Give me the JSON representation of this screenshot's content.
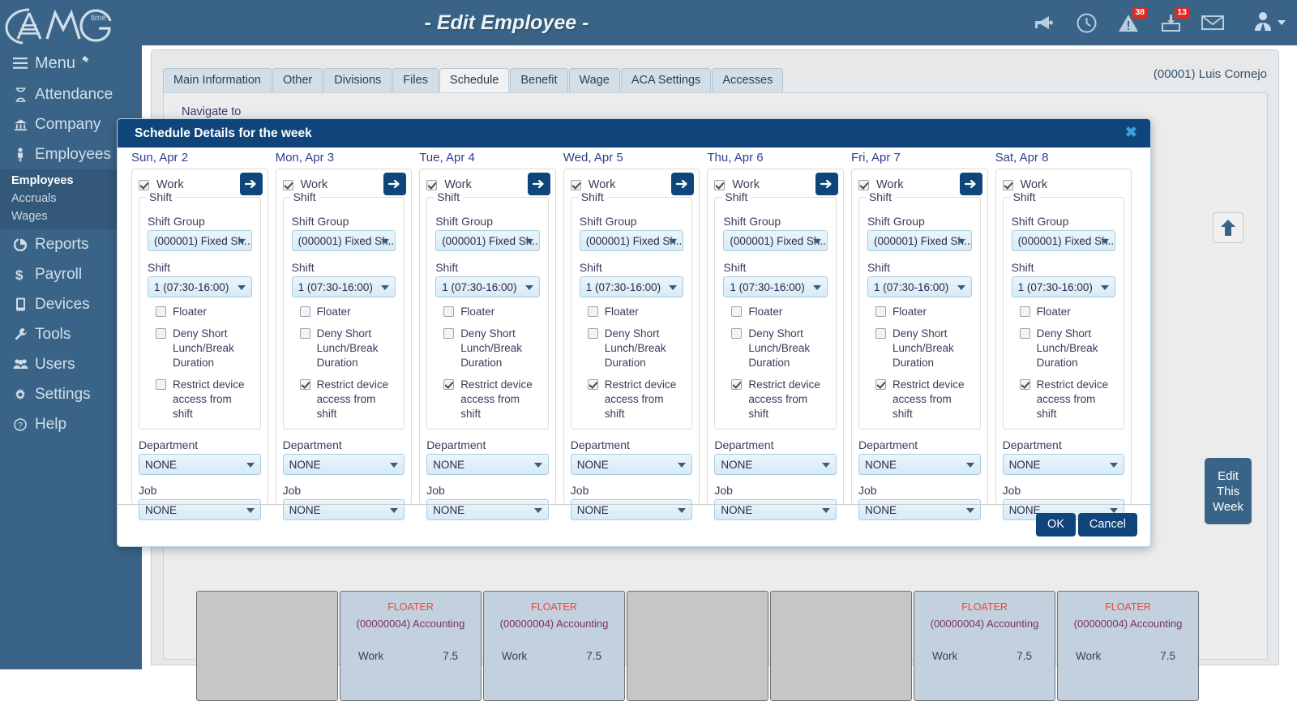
{
  "app": {
    "logo_text": "AMG",
    "logo_sub": "time",
    "title": "- Edit Employee -"
  },
  "sidebar": {
    "menu_label": "Menu",
    "items": [
      {
        "label": "Attendance",
        "icon": "hourglass-icon"
      },
      {
        "label": "Company",
        "icon": "bank-icon"
      },
      {
        "label": "Employees",
        "icon": "person-icon"
      },
      {
        "label": "Reports",
        "icon": "pie-chart-icon"
      },
      {
        "label": "Payroll",
        "icon": "dollar-icon"
      },
      {
        "label": "Devices",
        "icon": "device-icon"
      },
      {
        "label": "Tools",
        "icon": "wrench-icon"
      },
      {
        "label": "Users",
        "icon": "users-icon"
      },
      {
        "label": "Settings",
        "icon": "gear-icon"
      },
      {
        "label": "Help",
        "icon": "question-circle-icon"
      }
    ],
    "sub_items": [
      {
        "label": "Employees",
        "active": true
      },
      {
        "label": "Accruals",
        "active": false
      },
      {
        "label": "Wages",
        "active": false
      }
    ]
  },
  "topbar": {
    "icons": [
      {
        "name": "megaphone-icon",
        "badge": ""
      },
      {
        "name": "clock-icon",
        "badge": ""
      },
      {
        "name": "warning-icon",
        "badge": "38"
      },
      {
        "name": "inbox-icon",
        "badge": "13"
      },
      {
        "name": "envelope-icon",
        "badge": ""
      }
    ],
    "user_icon": "user-avatar-icon"
  },
  "page": {
    "employee_name": "(00001) Luis Cornejo",
    "navigate_to": "Navigate to",
    "edit_this_week": "Edit\nThis\nWeek",
    "tabs": [
      {
        "label": "Main Information",
        "active": false
      },
      {
        "label": "Other",
        "active": false
      },
      {
        "label": "Divisions",
        "active": false
      },
      {
        "label": "Files",
        "active": false
      },
      {
        "label": "Schedule",
        "active": true
      },
      {
        "label": "Benefit",
        "active": false
      },
      {
        "label": "Wage",
        "active": false
      },
      {
        "label": "ACA Settings",
        "active": false
      },
      {
        "label": "Accesses",
        "active": false
      }
    ],
    "schedule_grid": [
      {
        "filled": false,
        "floater": "",
        "dept": "",
        "work": "",
        "hours": ""
      },
      {
        "filled": true,
        "floater": "FLOATER",
        "dept": "(00000004) Accounting",
        "work": "Work",
        "hours": "7.5"
      },
      {
        "filled": true,
        "floater": "FLOATER",
        "dept": "(00000004) Accounting",
        "work": "Work",
        "hours": "7.5"
      },
      {
        "filled": false,
        "floater": "",
        "dept": "",
        "work": "",
        "hours": ""
      },
      {
        "filled": false,
        "floater": "",
        "dept": "",
        "work": "",
        "hours": ""
      },
      {
        "filled": true,
        "floater": "FLOATER",
        "dept": "(00000004) Accounting",
        "work": "Work",
        "hours": "7.5"
      },
      {
        "filled": true,
        "floater": "FLOATER",
        "dept": "(00000004) Accounting",
        "work": "Work",
        "hours": "7.5"
      }
    ]
  },
  "modal": {
    "title": "Schedule Details for the week",
    "close_glyph": "✖",
    "ok_label": "OK",
    "cancel_label": "Cancel",
    "labels": {
      "work": "Work",
      "shift_legend": "Shift",
      "shift_group": "Shift Group",
      "shift": "Shift",
      "floater": "Floater",
      "deny_short": "Deny Short Lunch/Break Duration",
      "restrict_device": "Restrict device access from shift",
      "department": "Department",
      "job": "Job"
    },
    "days": [
      {
        "title": "Sun, Apr 2",
        "work_checked": true,
        "has_arrow": true,
        "shift_group": "(000001) Fixed Sh...",
        "shift": "1 (07:30-16:00)",
        "floater": false,
        "deny_short": false,
        "restrict_device": false,
        "department": "NONE",
        "job": "NONE"
      },
      {
        "title": "Mon, Apr 3",
        "work_checked": true,
        "has_arrow": true,
        "shift_group": "(000001) Fixed Sh...",
        "shift": "1 (07:30-16:00)",
        "floater": false,
        "deny_short": false,
        "restrict_device": true,
        "department": "NONE",
        "job": "NONE"
      },
      {
        "title": "Tue, Apr 4",
        "work_checked": true,
        "has_arrow": true,
        "shift_group": "(000001) Fixed Sh...",
        "shift": "1 (07:30-16:00)",
        "floater": false,
        "deny_short": false,
        "restrict_device": true,
        "department": "NONE",
        "job": "NONE"
      },
      {
        "title": "Wed, Apr 5",
        "work_checked": true,
        "has_arrow": true,
        "shift_group": "(000001) Fixed Sh...",
        "shift": "1 (07:30-16:00)",
        "floater": false,
        "deny_short": false,
        "restrict_device": true,
        "department": "NONE",
        "job": "NONE"
      },
      {
        "title": "Thu, Apr 6",
        "work_checked": true,
        "has_arrow": true,
        "shift_group": "(000001) Fixed Sh...",
        "shift": "1 (07:30-16:00)",
        "floater": false,
        "deny_short": false,
        "restrict_device": true,
        "department": "NONE",
        "job": "NONE"
      },
      {
        "title": "Fri, Apr 7",
        "work_checked": true,
        "has_arrow": true,
        "shift_group": "(000001) Fixed Sh...",
        "shift": "1 (07:30-16:00)",
        "floater": false,
        "deny_short": false,
        "restrict_device": true,
        "department": "NONE",
        "job": "NONE"
      },
      {
        "title": "Sat, Apr 8",
        "work_checked": true,
        "has_arrow": false,
        "shift_group": "(000001) Fixed Sh...",
        "shift": "1 (07:30-16:00)",
        "floater": false,
        "deny_short": false,
        "restrict_device": true,
        "department": "NONE",
        "job": "NONE"
      }
    ]
  },
  "colors": {
    "brand": "#3a6487",
    "modal_header": "#10457c",
    "badge": "#e02b20",
    "floater_text": "#e8493a"
  }
}
